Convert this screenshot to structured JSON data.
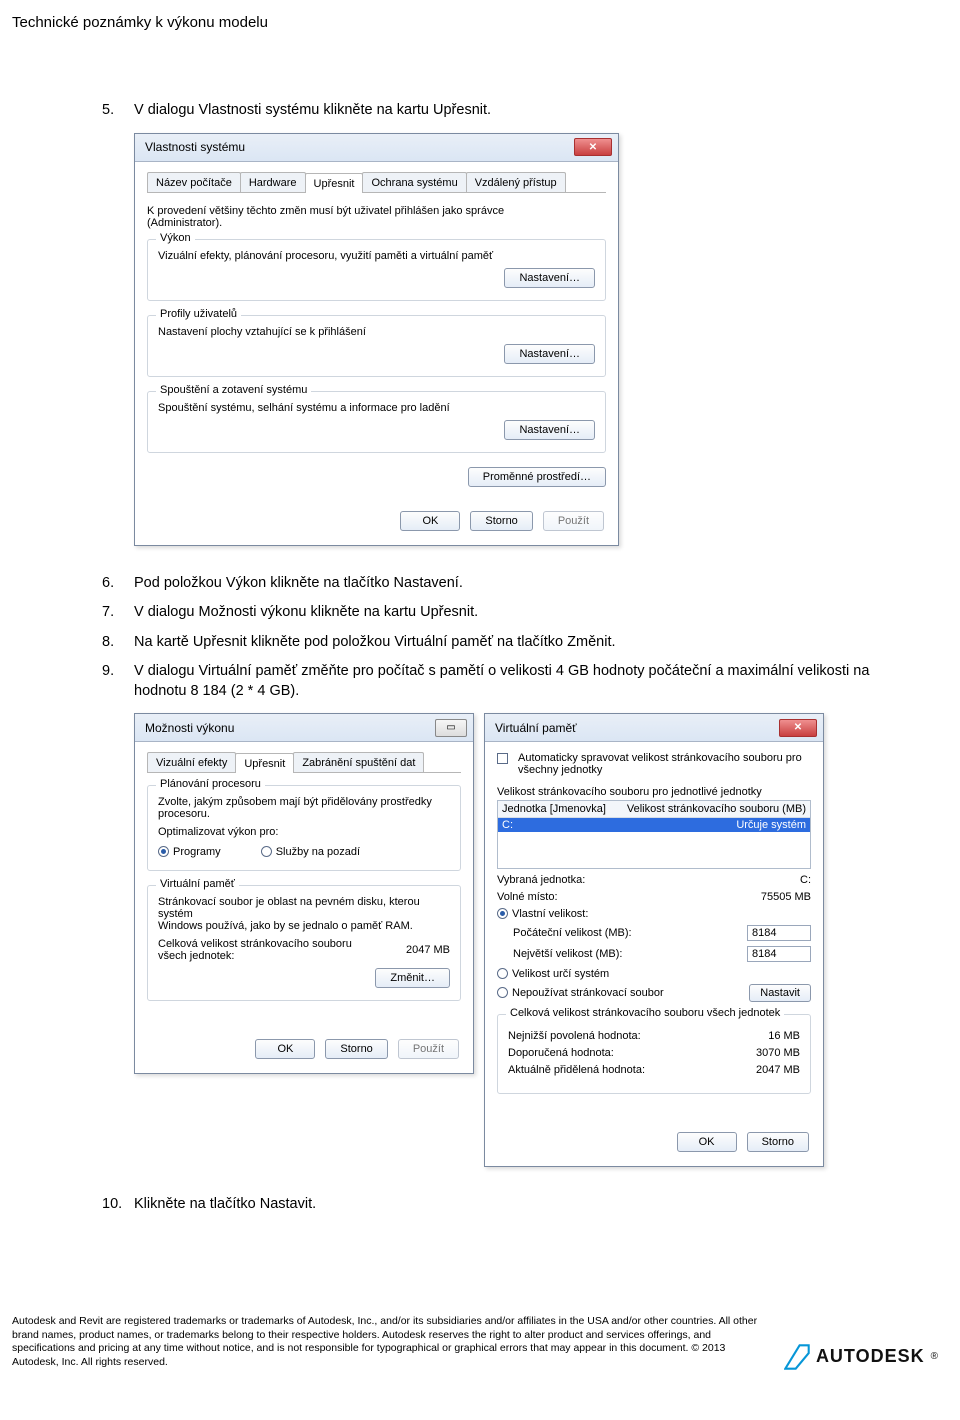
{
  "header": {
    "title": "Technické poznámky k výkonu modelu"
  },
  "steps_a": [
    {
      "num": "5.",
      "text": "V dialogu Vlastnosti systému klikněte na kartu Upřesnit."
    }
  ],
  "dlg1": {
    "title": "Vlastnosti systému",
    "tabs": [
      "Název počítače",
      "Hardware",
      "Upřesnit",
      "Ochrana systému",
      "Vzdálený přístup"
    ],
    "active_tab_index": 2,
    "intro_line1": "K provedení většiny těchto změn musí být uživatel přihlášen jako správce",
    "intro_line2": "(Administrator).",
    "perf_title": "Výkon",
    "perf_desc": "Vizuální efekty, plánování procesoru, využití paměti a virtuální paměť",
    "perf_btn": "Nastavení…",
    "profiles_title": "Profily uživatelů",
    "profiles_desc": "Nastavení plochy vztahující se k přihlášení",
    "profiles_btn": "Nastavení…",
    "startup_title": "Spouštění a zotavení systému",
    "startup_desc": "Spouštění systému, selhání systému a informace pro ladění",
    "startup_btn": "Nastavení…",
    "envvars_btn": "Proměnné prostředí…",
    "footer": {
      "ok": "OK",
      "cancel": "Storno",
      "apply": "Použít"
    }
  },
  "steps_b": [
    {
      "num": "6.",
      "text": "Pod položkou Výkon klikněte na tlačítko Nastavení."
    },
    {
      "num": "7.",
      "text": "V dialogu Možnosti výkonu klikněte na kartu Upřesnit."
    },
    {
      "num": "8.",
      "text": "Na kartě Upřesnit klikněte pod položkou Virtuální paměť na tlačítko Změnit."
    },
    {
      "num": "9.",
      "text": "V dialogu Virtuální paměť změňte pro počítač s pamětí o velikosti 4 GB hodnoty počáteční a maximální velikosti na hodnotu 8 184 (2 * 4 GB)."
    }
  ],
  "dlg2": {
    "title": "Možnosti výkonu",
    "tabs": [
      "Vizuální efekty",
      "Upřesnit",
      "Zabránění spuštění dat"
    ],
    "active_tab_index": 1,
    "g1": {
      "title": "Plánování procesoru",
      "line1": "Zvolte, jakým způsobem mají být přidělovány prostředky",
      "line2": "procesoru.",
      "opt_label": "Optimalizovat výkon pro:",
      "r1": "Programy",
      "r2": "Služby na pozadí"
    },
    "g2": {
      "title": "Virtuální paměť",
      "line1": "Stránkovací soubor je oblast na pevném disku, kterou systém",
      "line2": "Windows používá, jako by se jednalo o paměť RAM.",
      "total_label1": "Celková velikost stránkovacího souboru",
      "total_label2": "všech jednotek:",
      "total_value": "2047 MB",
      "btn": "Změnit…"
    },
    "footer": {
      "ok": "OK",
      "cancel": "Storno",
      "apply": "Použít"
    }
  },
  "dlg3": {
    "title": "Virtuální paměť",
    "auto_label1": "Automaticky spravovat velikost stránkovacího souboru pro",
    "auto_label2": "všechny jednotky",
    "list_head": "Velikost stránkovacího souboru pro jednotlivé jednotky",
    "th1": "Jednotka [Jmenovka]",
    "th2": "Velikost stránkovacího souboru (MB)",
    "row_drive": "C:",
    "row_val": "Určuje systém",
    "sel_drive_label": "Vybraná jednotka:",
    "sel_drive_value": "C:",
    "free_label": "Volné místo:",
    "free_value": "75505 MB",
    "r_custom": "Vlastní velikost:",
    "init_label": "Počáteční velikost (MB):",
    "init_value": "8184",
    "max_label": "Největší velikost (MB):",
    "max_value": "8184",
    "r_system": "Velikost určí systém",
    "r_none": "Nepoužívat stránkovací soubor",
    "set_btn": "Nastavit",
    "tot_title": "Celková velikost stránkovacího souboru všech jednotek",
    "min_label": "Nejnižší povolená hodnota:",
    "min_value": "16 MB",
    "rec_label": "Doporučená hodnota:",
    "rec_value": "3070 MB",
    "cur_label": "Aktuálně přidělená hodnota:",
    "cur_value": "2047 MB",
    "footer": {
      "ok": "OK",
      "cancel": "Storno"
    }
  },
  "steps_c": [
    {
      "num": "10.",
      "text": "Klikněte na tlačítko Nastavit."
    }
  ],
  "footer": {
    "legal": "Autodesk and Revit are registered trademarks or trademarks of Autodesk, Inc., and/or its subsidiaries and/or affiliates in the USA and/or other countries. All other brand names, product names, or trademarks belong to their respective holders. Autodesk reserves the right to alter product and services offerings, and specifications and pricing at any time without notice, and is not responsible for typographical or graphical errors that may appear in this document. © 2013 Autodesk, Inc. All rights reserved.",
    "brand": "AUTODESK"
  }
}
